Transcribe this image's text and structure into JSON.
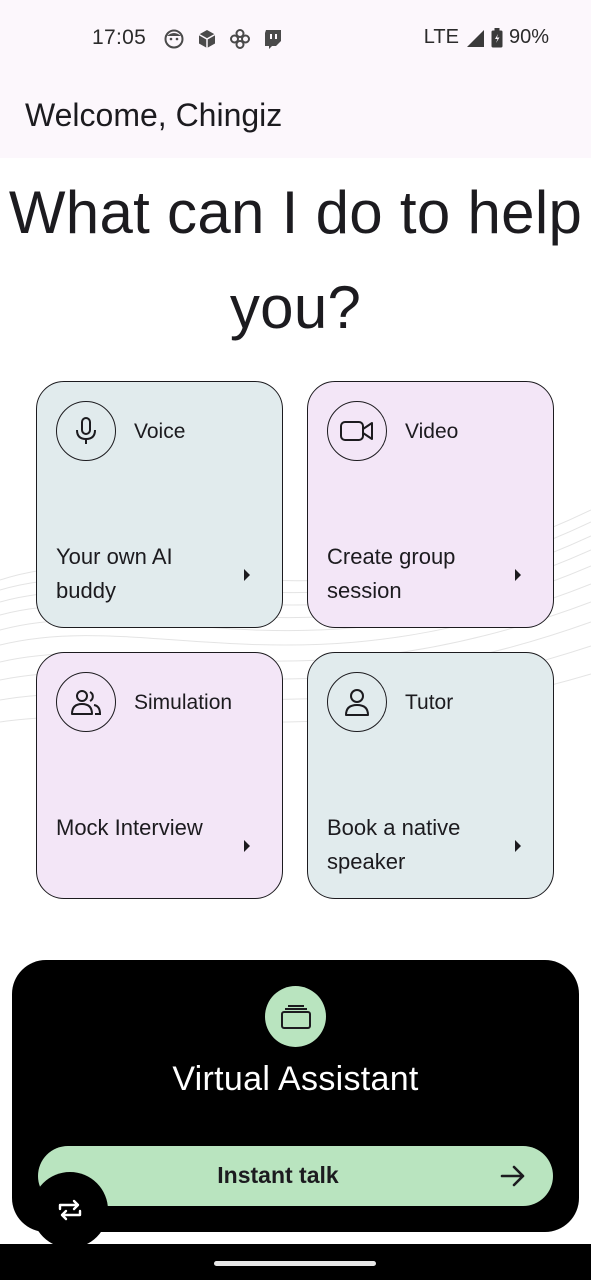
{
  "status_bar": {
    "time": "17:05",
    "network": "LTE",
    "battery": "90%",
    "notification_icons": [
      "face-icon",
      "package-icon",
      "pinwheel-icon",
      "twitch-icon"
    ]
  },
  "header": {
    "welcome": "Welcome, Chingiz"
  },
  "headline": "What can I do to help you?",
  "cards": [
    {
      "title": "Voice",
      "desc": "Your own AI buddy",
      "icon": "microphone-icon",
      "bg": "#e1ebed"
    },
    {
      "title": "Video",
      "desc": "Create group session",
      "icon": "video-camera-icon",
      "bg": "#f3e6f7"
    },
    {
      "title": "Simulation",
      "desc": "Mock Interview",
      "icon": "people-icon",
      "bg": "#f3e6f7"
    },
    {
      "title": "Tutor",
      "desc": "Book a native speaker",
      "icon": "person-icon",
      "bg": "#e1ebed"
    }
  ],
  "assistant": {
    "title": "Virtual Assistant",
    "icon": "cards-stack-icon",
    "button_label": "Instant talk",
    "button_icon": "arrow-right-icon"
  },
  "fab": {
    "icon": "repeat-icon"
  },
  "colors": {
    "accent_green": "#b9e4bf",
    "card_mint": "#e1ebed",
    "card_lilac": "#f3e6f7",
    "header_bg": "#fcf7fc"
  }
}
